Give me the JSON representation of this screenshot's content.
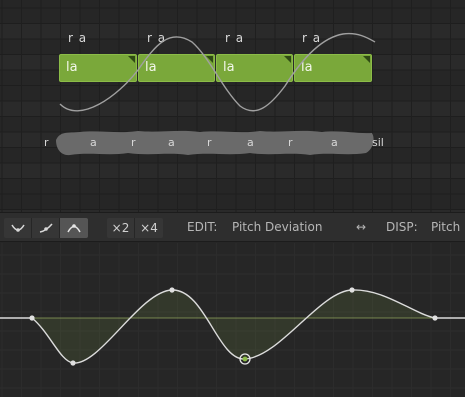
{
  "roll": {
    "top_phonemes": [
      "r a",
      "r a",
      "r a",
      "r a"
    ],
    "notes": [
      {
        "lyric": "la"
      },
      {
        "lyric": "la"
      },
      {
        "lyric": "la"
      },
      {
        "lyric": "la"
      }
    ],
    "phoneme_row": [
      "r",
      "a",
      "r",
      "a",
      "r",
      "a",
      "r",
      "a",
      "sil"
    ]
  },
  "toolbar": {
    "shape_tools": [
      {
        "icon": "curve-valley-icon"
      },
      {
        "icon": "curve-ramp-icon"
      },
      {
        "icon": "curve-peak-icon",
        "active": true
      }
    ],
    "multipliers": [
      "×2",
      "×4"
    ],
    "edit_label": "EDIT:",
    "edit_value": "Pitch Deviation",
    "swap_icon": "↔",
    "disp_label": "DISP:",
    "disp_value": "Pitch"
  },
  "colors": {
    "note_fill": "#7aa83a",
    "curve": "#dcdcdc",
    "baseline": "#a8c26a",
    "waveform": "#6a6a6a"
  }
}
